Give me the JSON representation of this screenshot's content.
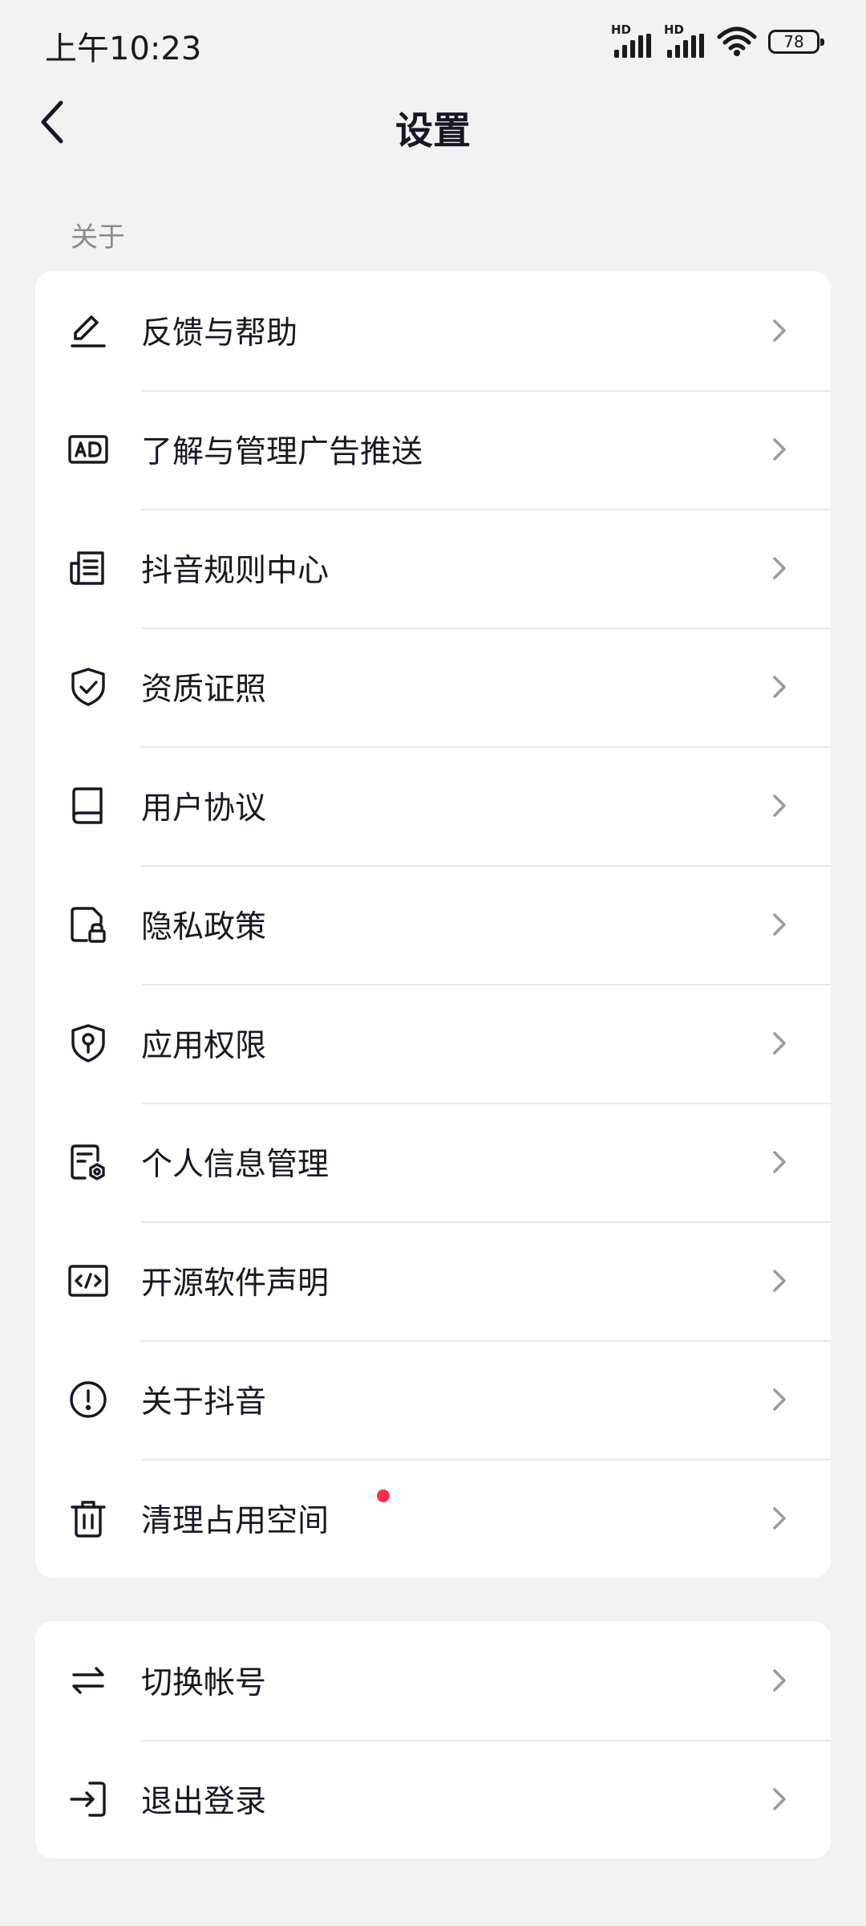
{
  "status_bar": {
    "time": "上午10:23",
    "signal1_label": "HD",
    "signal2_label": "HD",
    "battery": "78"
  },
  "header": {
    "title": "设置"
  },
  "about_section": {
    "label": "关于",
    "items": [
      {
        "label": "反馈与帮助",
        "icon": "edit-pen-icon"
      },
      {
        "label": "了解与管理广告推送",
        "icon": "ad-icon"
      },
      {
        "label": "抖音规则中心",
        "icon": "document-list-icon"
      },
      {
        "label": "资质证照",
        "icon": "shield-check-icon"
      },
      {
        "label": "用户协议",
        "icon": "book-icon"
      },
      {
        "label": "隐私政策",
        "icon": "file-lock-icon"
      },
      {
        "label": "应用权限",
        "icon": "shield-key-icon"
      },
      {
        "label": "个人信息管理",
        "icon": "file-settings-icon"
      },
      {
        "label": "开源软件声明",
        "icon": "code-icon"
      },
      {
        "label": "关于抖音",
        "icon": "info-exclamation-icon"
      },
      {
        "label": "清理占用空间",
        "icon": "trash-icon",
        "badge": "red-dot"
      }
    ]
  },
  "account_section": {
    "items": [
      {
        "label": "切换帐号",
        "icon": "switch-arrows-icon"
      },
      {
        "label": "退出登录",
        "icon": "logout-icon"
      }
    ]
  },
  "colors": {
    "background": "#f2f2f3",
    "card": "#ffffff",
    "text": "#161823",
    "secondary_text": "#8a8b91",
    "chevron": "#9a9ba0",
    "badge": "#fe2c55"
  }
}
